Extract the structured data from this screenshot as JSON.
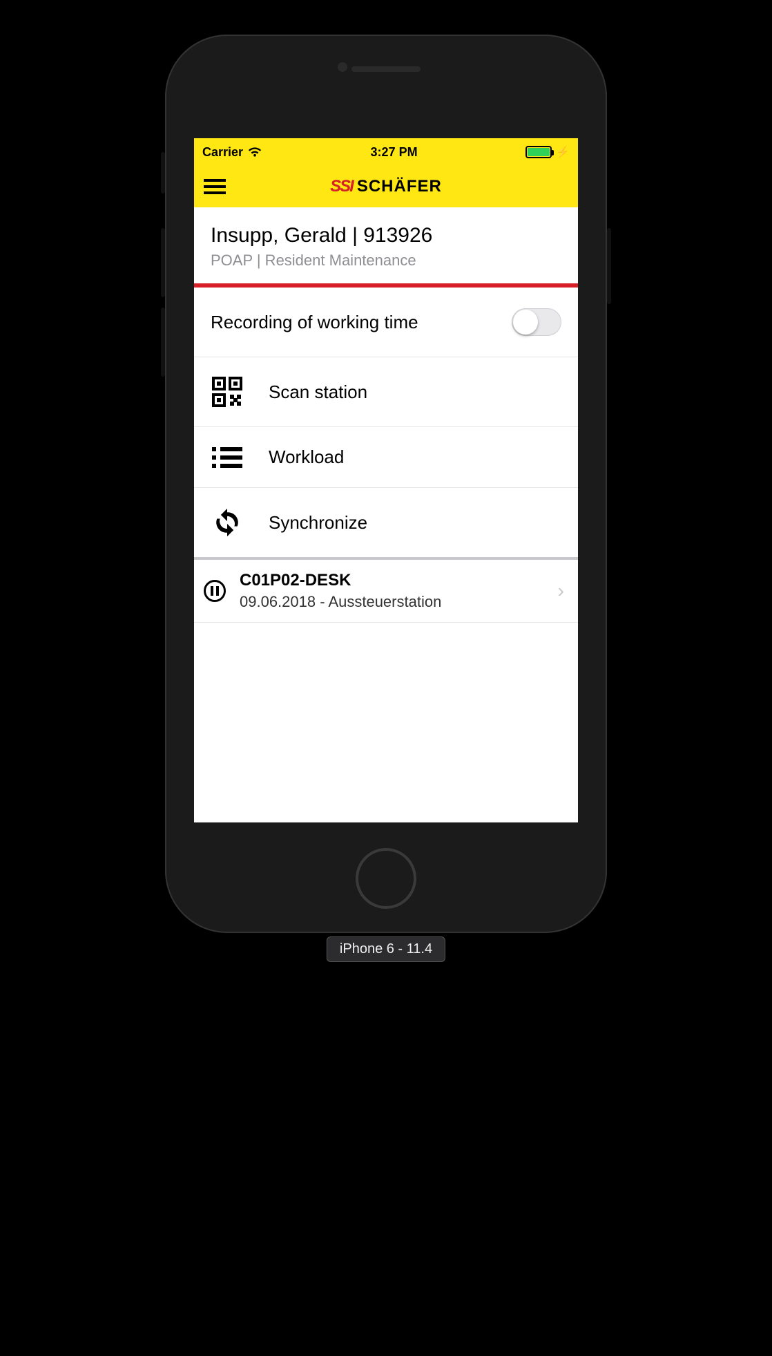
{
  "statusbar": {
    "carrier": "Carrier",
    "time": "3:27 PM"
  },
  "logo": {
    "part1": "SSI",
    "part2": "SCHÄFER"
  },
  "user": {
    "name_line": "Insupp, Gerald | 913926",
    "subtitle": "POAP | Resident Maintenance"
  },
  "toggle": {
    "label": "Recording of working time",
    "on": false
  },
  "menu": {
    "scan": "Scan station",
    "workload": "Workload",
    "sync": "Synchronize"
  },
  "station": {
    "title": "C01P02-DESK",
    "subtitle": "09.06.2018 - Aussteuerstation"
  },
  "device_label": "iPhone 6 - 11.4"
}
